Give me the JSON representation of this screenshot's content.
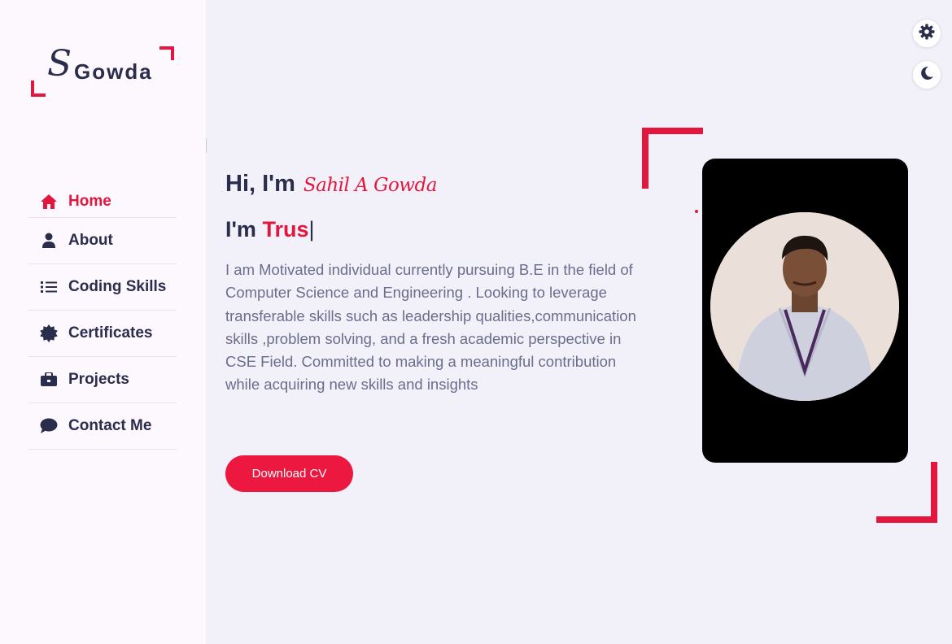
{
  "logo": {
    "letter": "S",
    "name": "Gowda"
  },
  "nav": {
    "items": [
      {
        "label": "Home",
        "icon": "home-icon",
        "active": true
      },
      {
        "label": "About",
        "icon": "user-icon"
      },
      {
        "label": "Coding Skills",
        "icon": "list-icon"
      },
      {
        "label": "Certificates",
        "icon": "certificate-icon"
      },
      {
        "label": "Projects",
        "icon": "briefcase-icon"
      },
      {
        "label": "Contact Me",
        "icon": "chat-icon"
      }
    ]
  },
  "hero": {
    "greeting": "Hi, I'm",
    "name": "Sahil A Gowda",
    "role_prefix": "I'm",
    "role_typed": "Trus",
    "cursor": "|",
    "description": "I am Motivated individual currently pursuing B.E in the field of Computer Science and Engineering . Looking to leverage transferable skills such as leadership qualities,communication skills ,problem solving, and a fresh academic perspective in CSE Field. Committed to making a meaningful contribution while acquiring new skills and insights",
    "cta_label": "Download CV"
  },
  "toolbar": {
    "settings_icon": "gear-icon",
    "theme_icon": "moon-icon"
  },
  "colors": {
    "accent": "#e3173e",
    "text": "#2b2d4d",
    "muted": "#6a6d8c",
    "bg": "#f2f1f9",
    "sidebar": "#fcf8fd"
  }
}
